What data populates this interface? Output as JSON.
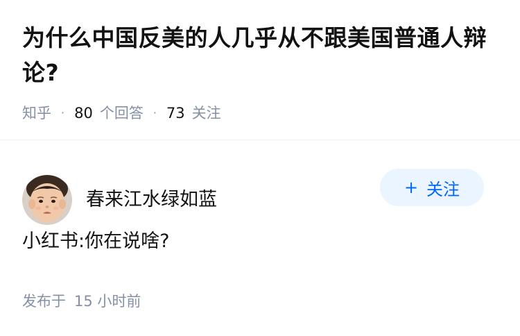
{
  "question": {
    "title": "为什么中国反美的人几乎从不跟美国普通人辩论?",
    "source": "知乎",
    "answer_count": "80",
    "answer_label": "个回答",
    "follow_count": "73",
    "follow_label": "关注"
  },
  "answer": {
    "author": {
      "name": "春来江水绿如蓝",
      "avatar": "child-avatar"
    },
    "follow_button": {
      "icon": "+",
      "label": "关注"
    },
    "content": "小红书:你在说啥?",
    "publish_prefix": "发布于",
    "publish_time": "15 小时前"
  },
  "colors": {
    "text": "#121212",
    "meta": "#8590a6",
    "accent": "#0066ff",
    "button_bg": "#ebf5ff"
  }
}
